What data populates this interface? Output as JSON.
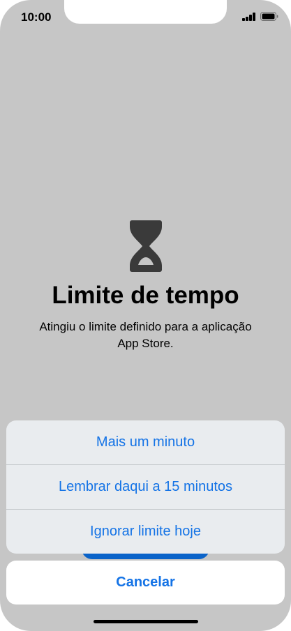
{
  "status_bar": {
    "time": "10:00",
    "signal_icon": "cellular-signal-icon",
    "battery_icon": "battery-icon"
  },
  "content": {
    "icon": "hourglass-icon",
    "title": "Limite de tempo",
    "message_line1": "Atingiu o limite definido para a aplicação",
    "message_line2": "App Store."
  },
  "action_sheet": {
    "actions": [
      {
        "label": "Mais um minuto"
      },
      {
        "label": "Lembrar daqui a 15 minutos"
      },
      {
        "label": "Ignorar limite hoje"
      }
    ],
    "cancel_label": "Cancelar"
  },
  "colors": {
    "accent": "#1473e6",
    "dimmed_background": "#c6c6c6",
    "sheet_background": "#e9ecef"
  }
}
